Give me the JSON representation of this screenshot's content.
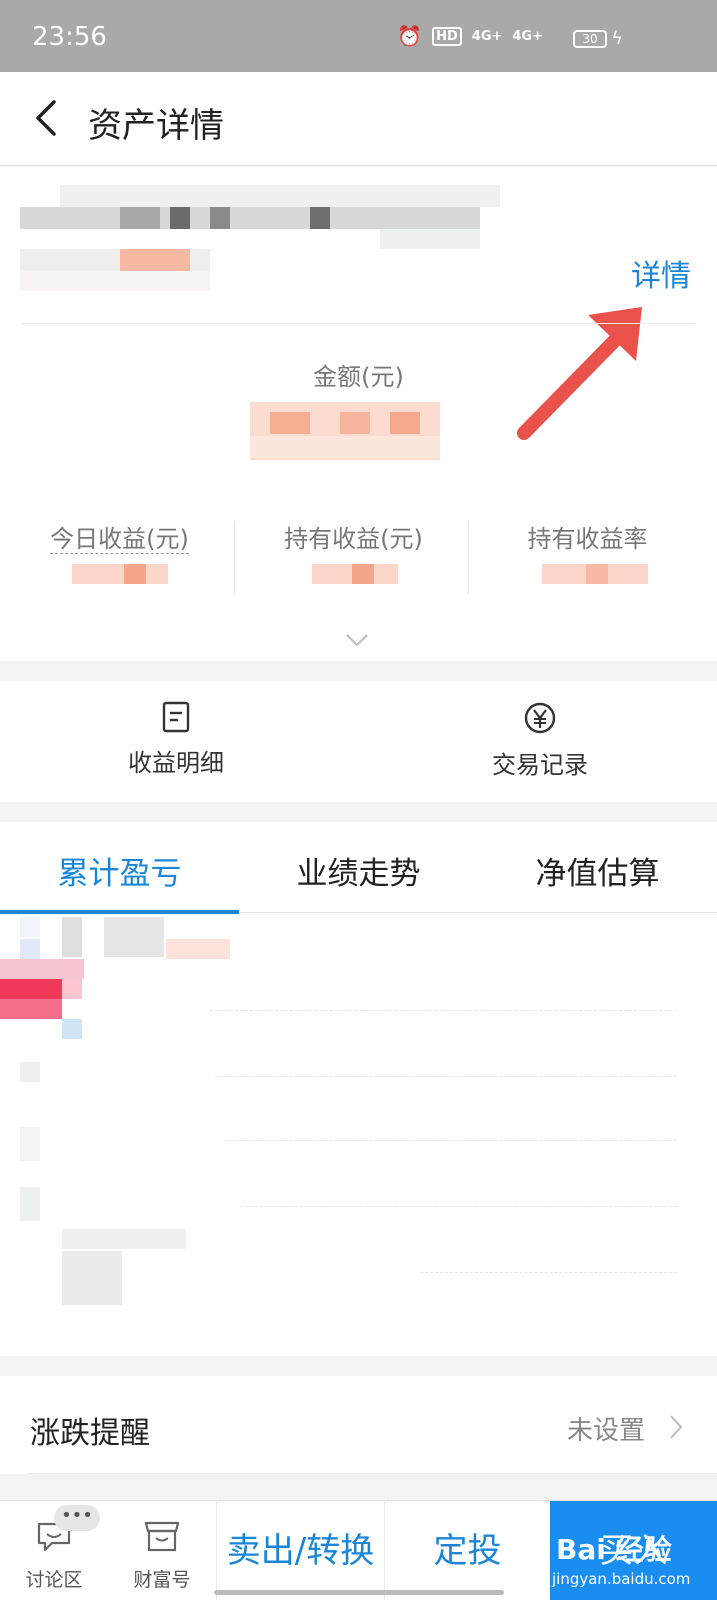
{
  "status_bar": {
    "time": "23:56",
    "network_1": "4G+",
    "network_2": "4G+",
    "hd_label": "HD",
    "battery": "30"
  },
  "header": {
    "title": "资产详情"
  },
  "asset_card": {
    "detail_link": "详情",
    "amount_label": "金额(元)",
    "stats": [
      {
        "label": "今日收益(元)"
      },
      {
        "label": "持有收益(元)"
      },
      {
        "label": "持有收益率"
      }
    ]
  },
  "actions": [
    {
      "label": "收益明细",
      "icon": "document-icon"
    },
    {
      "label": "交易记录",
      "icon": "yuan-circle-icon"
    }
  ],
  "tabs": [
    {
      "label": "累计盈亏",
      "active": true
    },
    {
      "label": "业绩走势",
      "active": false
    },
    {
      "label": "净值估算",
      "active": false
    }
  ],
  "alert": {
    "label": "涨跌提醒",
    "value": "未设置"
  },
  "bottom_bar": {
    "discussion": "讨论区",
    "wealth": "财富号",
    "more_badge": "•••",
    "sell_convert": "卖出/转换",
    "fixed_invest": "定投",
    "buy": "买入"
  },
  "watermark": {
    "brand": "Bai 经验",
    "url": "jingyan.baidu.com"
  },
  "colors": {
    "accent": "#1a86d8",
    "primary_button": "#1a8ef0",
    "arrow_annotation": "#e8524a"
  }
}
